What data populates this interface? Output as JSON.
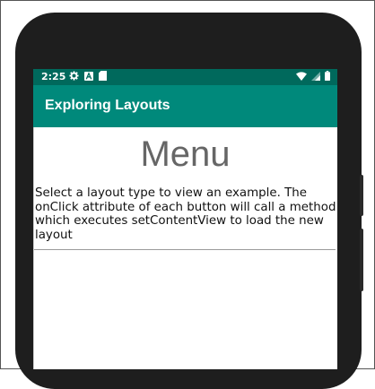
{
  "status_bar": {
    "time": "2:25",
    "left_icons": [
      "gear-icon",
      "a-icon",
      "sd-card-icon"
    ],
    "right_icons": [
      "wifi-icon",
      "signal-icon",
      "battery-icon"
    ]
  },
  "app_bar": {
    "title": "Exploring Layouts"
  },
  "main": {
    "heading": "Menu",
    "description": "Select a layout type to view an example. The onClick attribute of each button will call a method which executes setContentView to load the new layout"
  },
  "colors": {
    "status_bar": "#00695c",
    "app_bar": "#00897b",
    "heading_text": "#666666"
  }
}
